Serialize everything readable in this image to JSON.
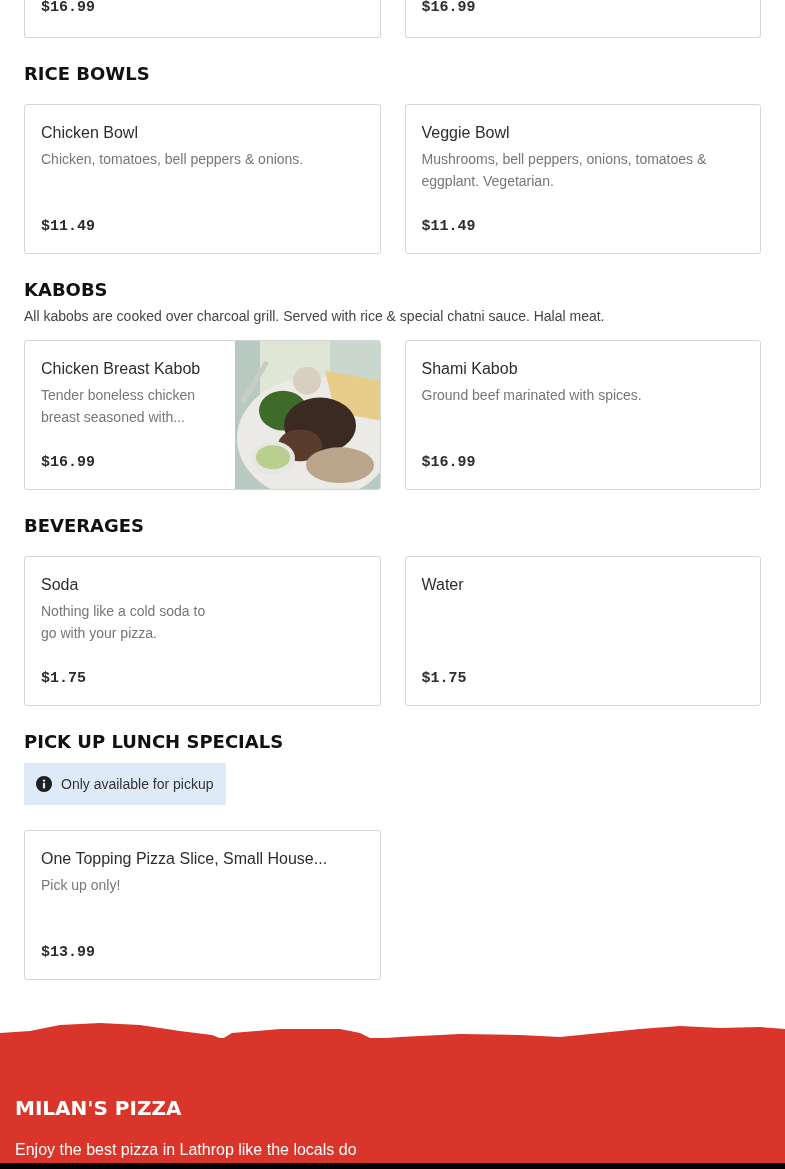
{
  "partial_row": [
    {
      "price": "$16.99"
    },
    {
      "price": "$16.99"
    }
  ],
  "sections": [
    {
      "title": "RICE BOWLS",
      "items": [
        {
          "name": "Chicken Bowl",
          "description": "Chicken, tomatoes, bell peppers & onions.",
          "price": "$11.49"
        },
        {
          "name": "Veggie Bowl",
          "description": "Mushrooms, bell peppers, onions, tomatoes & eggplant. Vegetarian.",
          "price": "$11.49"
        }
      ]
    },
    {
      "title": "KABOBS",
      "description": "All kabobs are cooked over charcoal grill. Served with rice & special chatni sauce. Halal meat.",
      "items": [
        {
          "name": "Chicken Breast Kabob",
          "description": "Tender boneless chicken breast seasoned with...",
          "price": "$16.99"
        },
        {
          "name": "Shami Kabob",
          "description": "Ground beef marinated with spices.",
          "price": "$16.99"
        }
      ]
    },
    {
      "title": "BEVERAGES",
      "items": [
        {
          "name": "Soda",
          "description": "Nothing like a cold soda to\ngo with your pizza.",
          "price": "$1.75"
        },
        {
          "name": "Water",
          "price": "$1.75"
        }
      ]
    },
    {
      "title": "PICK UP LUNCH SPECIALS",
      "notice": "Only available for pickup",
      "items": [
        {
          "name": "One Topping Pizza Slice, Small House...",
          "description": "Pick up only!",
          "price": "$13.99"
        }
      ]
    }
  ],
  "footer": {
    "title": "MILAN'S PIZZA",
    "text": "Enjoy the best pizza in Lathrop like the locals do"
  }
}
